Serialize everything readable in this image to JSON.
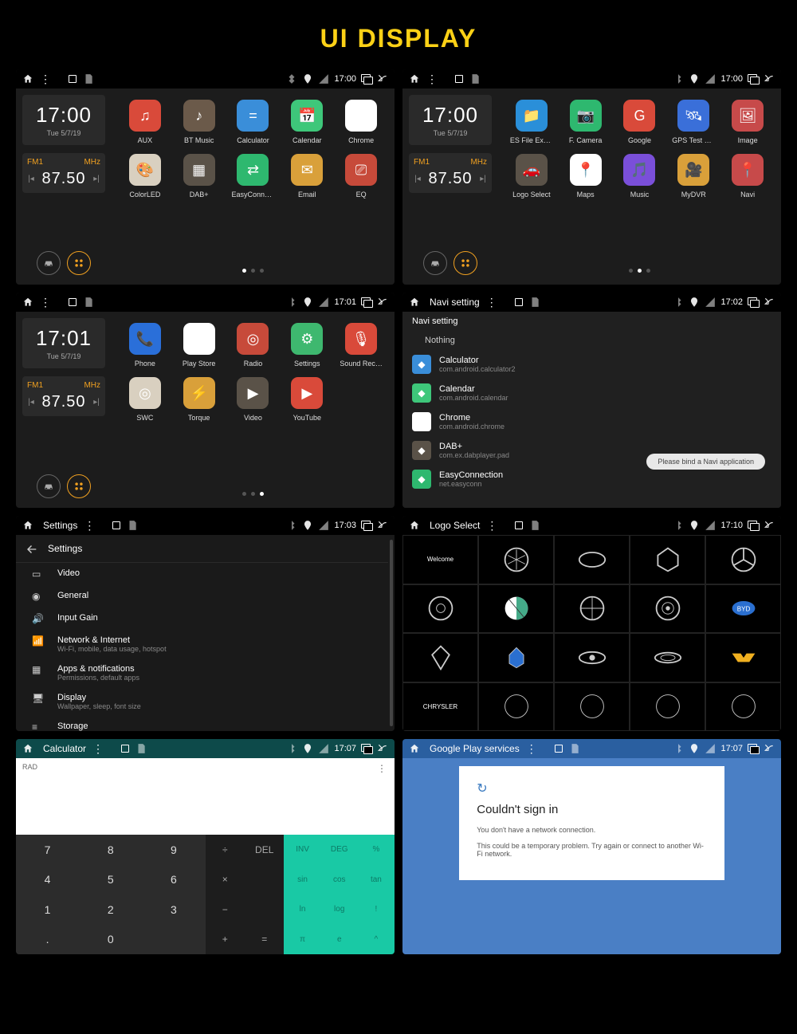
{
  "header_title": "UI DISPLAY",
  "status": {
    "time_1700": "17:00",
    "time_1701": "17:01",
    "time_1702": "17:02",
    "time_1703": "17:03",
    "time_1707": "17:07",
    "time_1710": "17:10"
  },
  "clock": {
    "time": "17:00",
    "date": "Tue 5/7/19"
  },
  "clock2": {
    "time": "17:01",
    "date": "Tue 5/7/19"
  },
  "radio": {
    "band": "FM1",
    "unit": "MHz",
    "freq": "87.50"
  },
  "screens": {
    "s1_apps": [
      {
        "label": "AUX",
        "bg": "#d94a3a",
        "glyph": "♫"
      },
      {
        "label": "BT Music",
        "bg": "#6b5a4a",
        "glyph": "♪"
      },
      {
        "label": "Calculator",
        "bg": "#3a8ed9",
        "glyph": "="
      },
      {
        "label": "Calendar",
        "bg": "#3ec77a",
        "glyph": "📅"
      },
      {
        "label": "Chrome",
        "bg": "#fff",
        "glyph": "◉"
      },
      {
        "label": "ColorLED",
        "bg": "#d9d0c0",
        "glyph": "🎨"
      },
      {
        "label": "DAB+",
        "bg": "#5a5248",
        "glyph": "▦"
      },
      {
        "label": "EasyConne…",
        "bg": "#2eb86f",
        "glyph": "⇄"
      },
      {
        "label": "Email",
        "bg": "#d9a03a",
        "glyph": "✉"
      },
      {
        "label": "EQ",
        "bg": "#c74a3a",
        "glyph": "⎚"
      }
    ],
    "s2_apps": [
      {
        "label": "ES File Expl…",
        "bg": "#2a8fd9",
        "glyph": "📁"
      },
      {
        "label": "F. Camera",
        "bg": "#2eb86f",
        "glyph": "📷"
      },
      {
        "label": "Google",
        "bg": "#d94a3a",
        "glyph": "G"
      },
      {
        "label": "GPS Test Pl…",
        "bg": "#3a6fd9",
        "glyph": "🛰"
      },
      {
        "label": "Image",
        "bg": "#c74a4a",
        "glyph": "🖼"
      },
      {
        "label": "Logo Select",
        "bg": "#5a5248",
        "glyph": "🚗"
      },
      {
        "label": "Maps",
        "bg": "#ffffff",
        "glyph": "📍"
      },
      {
        "label": "Music",
        "bg": "#7a4fd9",
        "glyph": "🎵"
      },
      {
        "label": "MyDVR",
        "bg": "#d9a03a",
        "glyph": "🎥"
      },
      {
        "label": "Navi",
        "bg": "#c74a4a",
        "glyph": "📍"
      }
    ],
    "s3_apps": [
      {
        "label": "Phone",
        "bg": "#2a6fd9",
        "glyph": "📞"
      },
      {
        "label": "Play Store",
        "bg": "#fff",
        "glyph": "▶"
      },
      {
        "label": "Radio",
        "bg": "#c74a3a",
        "glyph": "◎"
      },
      {
        "label": "Settings",
        "bg": "#3eb86f",
        "glyph": "⚙"
      },
      {
        "label": "Sound Rec…",
        "bg": "#d94a3a",
        "glyph": "🎙"
      },
      {
        "label": "SWC",
        "bg": "#d9d0c0",
        "glyph": "◎"
      },
      {
        "label": "Torque",
        "bg": "#d9a03a",
        "glyph": "⚡"
      },
      {
        "label": "Video",
        "bg": "#5a5248",
        "glyph": "▶"
      },
      {
        "label": "YouTube",
        "bg": "#d94a3a",
        "glyph": "▶"
      }
    ]
  },
  "navi": {
    "title": "Navi setting",
    "header": "Navi setting",
    "nothing": "Nothing",
    "toast": "Please bind a Navi application",
    "items": [
      {
        "t": "Calculator",
        "s": "com.android.calculator2",
        "bg": "#3a8ed9"
      },
      {
        "t": "Calendar",
        "s": "com.android.calendar",
        "bg": "#3ec77a"
      },
      {
        "t": "Chrome",
        "s": "com.android.chrome",
        "bg": "#fff"
      },
      {
        "t": "DAB+",
        "s": "com.ex.dabplayer.pad",
        "bg": "#5a5248"
      },
      {
        "t": "EasyConnection",
        "s": "net.easyconn",
        "bg": "#2eb86f"
      }
    ]
  },
  "settings": {
    "title": "Settings",
    "header": "Settings",
    "items": [
      {
        "t": "Video",
        "s": ""
      },
      {
        "t": "General",
        "s": ""
      },
      {
        "t": "Input Gain",
        "s": ""
      },
      {
        "t": "Network & Internet",
        "s": "Wi-Fi, mobile, data usage, hotspot"
      },
      {
        "t": "Apps & notifications",
        "s": "Permissions, default apps"
      },
      {
        "t": "Display",
        "s": "Wallpaper, sleep, font size"
      },
      {
        "t": "Storage",
        "s": ""
      }
    ]
  },
  "logo": {
    "title": "Logo Select",
    "welcome": "Welcome"
  },
  "calc": {
    "title": "Calculator",
    "rad": "RAD",
    "nums": [
      "7",
      "8",
      "9",
      "4",
      "5",
      "6",
      "1",
      "2",
      "3",
      ".",
      "0",
      ""
    ],
    "ops": [
      "÷",
      "DEL",
      "×",
      "",
      "−",
      "",
      "+",
      "="
    ],
    "adv": [
      "INV",
      "DEG",
      "%",
      "sin",
      "cos",
      "tan",
      "ln",
      "log",
      "!",
      "π",
      "e",
      "^",
      "(",
      ")",
      "√"
    ]
  },
  "gps": {
    "title": "Google Play services",
    "h": "Couldn't sign in",
    "p1": "You don't have a network connection.",
    "p2": "This could be a temporary problem. Try again or connect to another Wi-Fi network."
  }
}
